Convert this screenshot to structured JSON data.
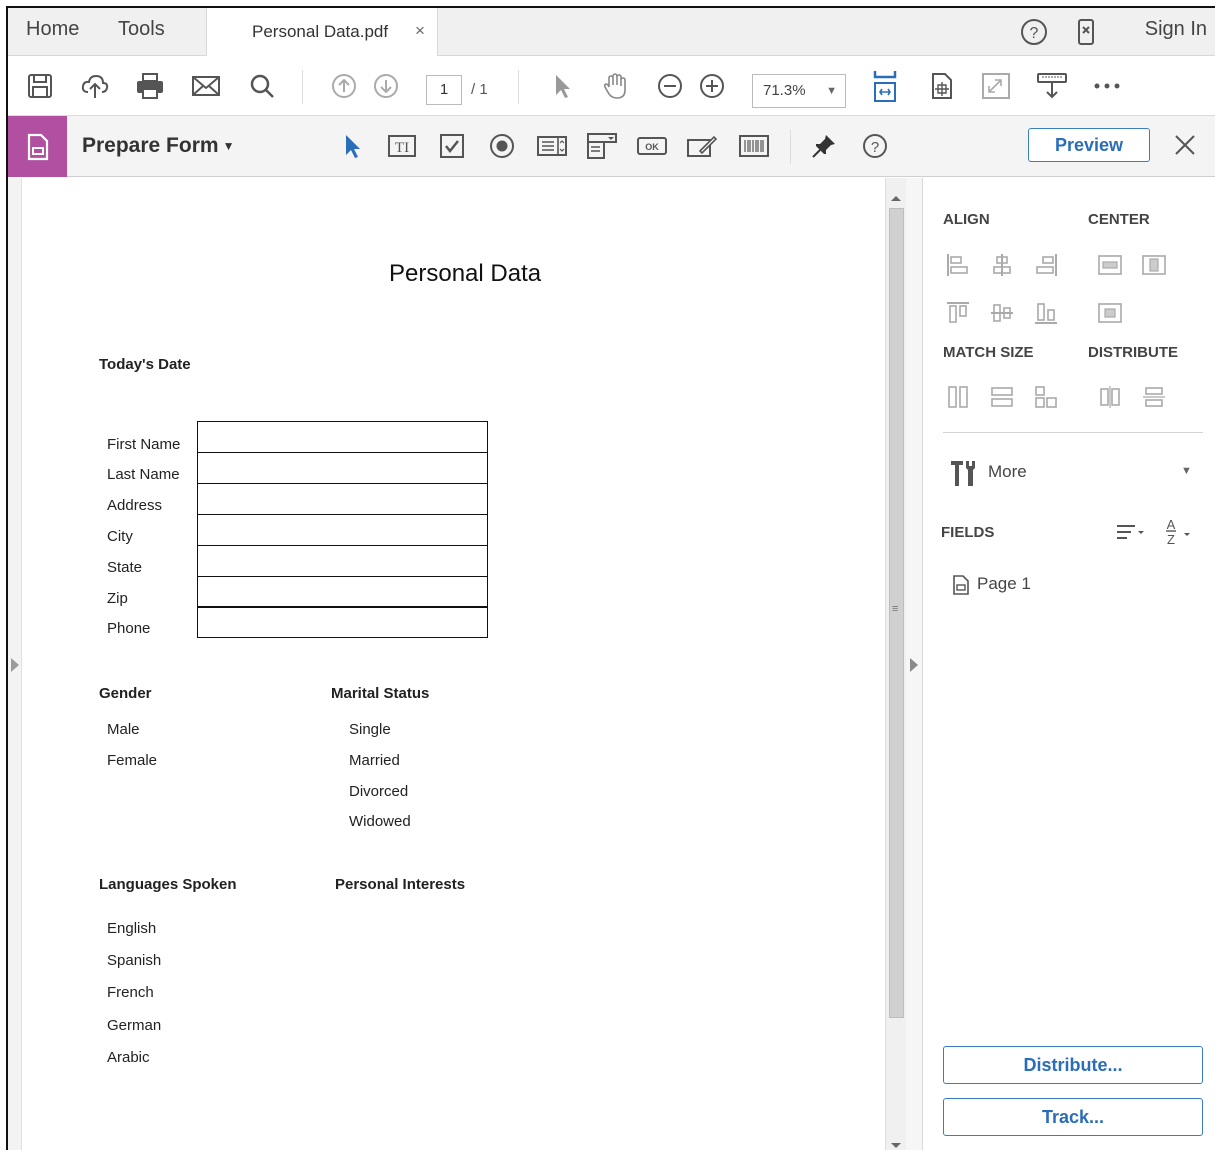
{
  "app": {
    "nav": {
      "home": "Home",
      "tools": "Tools"
    },
    "tab": {
      "title": "Personal Data.pdf",
      "close": "×"
    },
    "signin": "Sign In"
  },
  "toolbar": {
    "page_current": "1",
    "page_total": "/ 1",
    "zoom": "71.3%"
  },
  "formbar": {
    "title": "Prepare Form",
    "preview": "Preview"
  },
  "document": {
    "title": "Personal Data",
    "todays_date": "Today's Date",
    "fields": [
      "First Name",
      "Last Name",
      "Address",
      "City",
      "State",
      "Zip",
      "Phone"
    ],
    "gender": {
      "heading": "Gender",
      "options": [
        "Male",
        "Female"
      ]
    },
    "marital": {
      "heading": "Marital Status",
      "options": [
        "Single",
        "Married",
        "Divorced",
        "Widowed"
      ]
    },
    "languages": {
      "heading": "Languages Spoken",
      "options": [
        "English",
        "Spanish",
        "French",
        "German",
        "Arabic"
      ]
    },
    "interests": {
      "heading": "Personal Interests"
    }
  },
  "rightpane": {
    "align": "ALIGN",
    "center": "CENTER",
    "match_size": "MATCH SIZE",
    "distribute": "DISTRIBUTE",
    "more": "More",
    "fields": "FIELDS",
    "page_node": "Page 1",
    "distribute_btn": "Distribute...",
    "track_btn": "Track..."
  },
  "colors": {
    "form_badge": "#b150a0",
    "accent_blue": "#2a6db8"
  }
}
